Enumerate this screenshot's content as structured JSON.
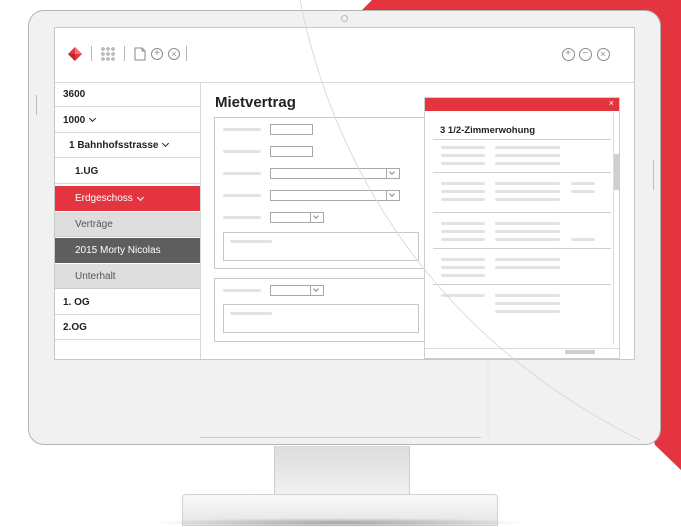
{
  "colors": {
    "accent_red": "#e4343f",
    "nav_active_bg": "#e4343f",
    "nav_sub_bg": "#dedede",
    "nav_selected_bg": "#5e5e5e"
  },
  "toolbar": {
    "icons": [
      "logo-diamond-icon",
      "grid-dots-icon",
      "document-icon",
      "add-circle-icon",
      "close-circle-icon"
    ],
    "right_icons": [
      "zoom-in-icon",
      "zoom-out-icon",
      "close-icon"
    ]
  },
  "sidebar": {
    "items": [
      {
        "label": "3600"
      },
      {
        "label": "1000"
      },
      {
        "label": "1 Bahnhofsstrasse"
      },
      {
        "label": "1.UG"
      },
      {
        "label": "Erdgeschoss"
      },
      {
        "label": "Verträge"
      },
      {
        "label": "2015 Morty Nicolas"
      },
      {
        "label": "Unterhalt"
      },
      {
        "label": "1. OG"
      },
      {
        "label": "2.OG"
      }
    ]
  },
  "main": {
    "title": "Mietvertrag"
  },
  "dialog": {
    "close_label": "×",
    "title": "3 1/2-Zimmerwohung"
  }
}
